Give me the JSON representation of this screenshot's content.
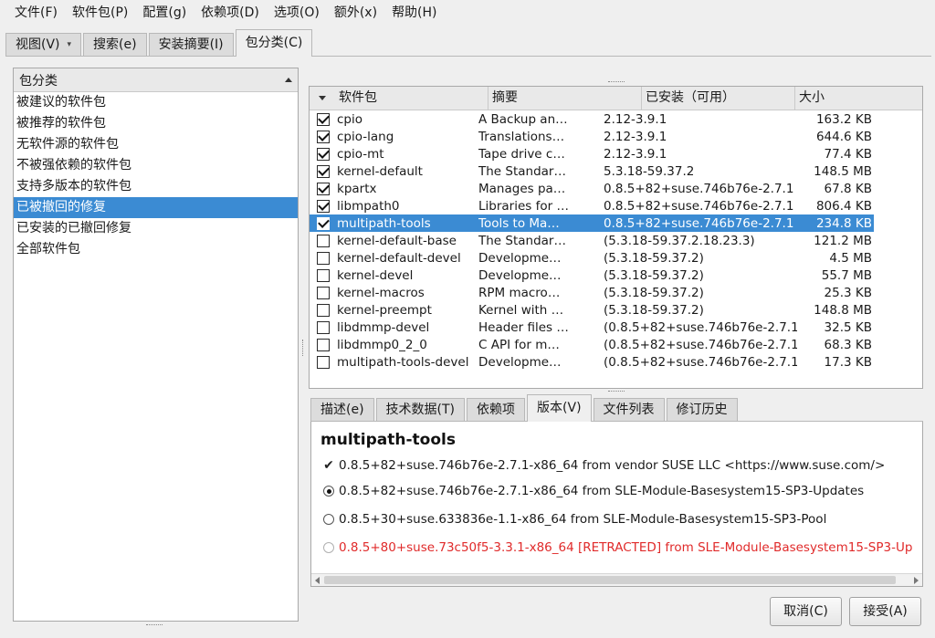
{
  "menubar": [
    "文件(F)",
    "软件包(P)",
    "配置(g)",
    "依赖项(D)",
    "选项(O)",
    "额外(x)",
    "帮助(H)"
  ],
  "main_tabs": [
    {
      "label": "视图(V)",
      "has_dropdown": true,
      "active": false
    },
    {
      "label": "搜索(e)",
      "active": false
    },
    {
      "label": "安装摘要(I)",
      "active": false
    },
    {
      "label": "包分类(C)",
      "active": true
    }
  ],
  "categories": {
    "header": "包分类",
    "items": [
      {
        "label": "被建议的软件包",
        "selected": false
      },
      {
        "label": "被推荐的软件包",
        "selected": false
      },
      {
        "label": "无软件源的软件包",
        "selected": false
      },
      {
        "label": "不被强依赖的软件包",
        "selected": false
      },
      {
        "label": "支持多版本的软件包",
        "selected": false
      },
      {
        "label": "已被撤回的修复",
        "selected": true
      },
      {
        "label": "已安装的已撤回修复",
        "selected": false
      },
      {
        "label": "全部软件包",
        "selected": false
      }
    ]
  },
  "packages": {
    "columns": {
      "name": "软件包",
      "summary": "摘要",
      "version": "已安装（可用）",
      "size": "大小"
    },
    "rows": [
      {
        "checked": true,
        "name": "cpio",
        "summary": "A Backup an…",
        "version": "2.12-3.9.1",
        "size": "163.2 KB",
        "selected": false
      },
      {
        "checked": true,
        "name": "cpio-lang",
        "summary": "Translations…",
        "version": "2.12-3.9.1",
        "size": "644.6 KB",
        "selected": false
      },
      {
        "checked": true,
        "name": "cpio-mt",
        "summary": "Tape drive c…",
        "version": "2.12-3.9.1",
        "size": "77.4 KB",
        "selected": false
      },
      {
        "checked": true,
        "name": "kernel-default",
        "summary": "The Standar…",
        "version": "5.3.18-59.37.2",
        "size": "148.5 MB",
        "selected": false
      },
      {
        "checked": true,
        "name": "kpartx",
        "summary": "Manages pa…",
        "version": "0.8.5+82+suse.746b76e-2.7.1",
        "size": "67.8 KB",
        "selected": false
      },
      {
        "checked": true,
        "name": "libmpath0",
        "summary": "Libraries for …",
        "version": "0.8.5+82+suse.746b76e-2.7.1",
        "size": "806.4 KB",
        "selected": false
      },
      {
        "checked": true,
        "name": "multipath-tools",
        "summary": "Tools to Ma…",
        "version": "0.8.5+82+suse.746b76e-2.7.1",
        "size": "234.8 KB",
        "selected": true
      },
      {
        "checked": false,
        "name": "kernel-default-base",
        "summary": "The Standar…",
        "version": "(5.3.18-59.37.2.18.23.3)",
        "size": "121.2 MB",
        "selected": false
      },
      {
        "checked": false,
        "name": "kernel-default-devel",
        "summary": "Developme…",
        "version": "(5.3.18-59.37.2)",
        "size": "4.5 MB",
        "selected": false
      },
      {
        "checked": false,
        "name": "kernel-devel",
        "summary": "Developme…",
        "version": "(5.3.18-59.37.2)",
        "size": "55.7 MB",
        "selected": false
      },
      {
        "checked": false,
        "name": "kernel-macros",
        "summary": "RPM macro…",
        "version": "(5.3.18-59.37.2)",
        "size": "25.3 KB",
        "selected": false
      },
      {
        "checked": false,
        "name": "kernel-preempt",
        "summary": "Kernel with …",
        "version": "(5.3.18-59.37.2)",
        "size": "148.8 MB",
        "selected": false
      },
      {
        "checked": false,
        "name": "libdmmp-devel",
        "summary": "Header files …",
        "version": "(0.8.5+82+suse.746b76e-2.7.1)",
        "size": "32.5 KB",
        "selected": false
      },
      {
        "checked": false,
        "name": "libdmmp0_2_0",
        "summary": "C API for m…",
        "version": "(0.8.5+82+suse.746b76e-2.7.1)",
        "size": "68.3 KB",
        "selected": false
      },
      {
        "checked": false,
        "name": "multipath-tools-devel",
        "summary": "Developme…",
        "version": "(0.8.5+82+suse.746b76e-2.7.1)",
        "size": "17.3 KB",
        "selected": false
      }
    ]
  },
  "detail_tabs": [
    {
      "label": "描述(e)",
      "active": false
    },
    {
      "label": "技术数据(T)",
      "active": false
    },
    {
      "label": "依赖项",
      "active": false
    },
    {
      "label": "版本(V)",
      "active": true
    },
    {
      "label": "文件列表",
      "active": false
    },
    {
      "label": "修订历史",
      "active": false
    }
  ],
  "versions": {
    "title": "multipath-tools",
    "lines": [
      {
        "mark": "check",
        "text": "0.8.5+82+suse.746b76e-2.7.1-x86_64 from vendor SUSE LLC <https://www.suse.com/>",
        "red": false
      },
      {
        "mark": "radio-on",
        "text": "0.8.5+82+suse.746b76e-2.7.1-x86_64 from SLE-Module-Basesystem15-SP3-Updates",
        "red": false
      },
      {
        "mark": "radio-off",
        "text": "0.8.5+30+suse.633836e-1.1-x86_64 from SLE-Module-Basesystem15-SP3-Pool",
        "red": false
      },
      {
        "mark": "radio-off-disabled",
        "text": "0.8.5+80+suse.73c50f5-3.3.1-x86_64 [RETRACTED] from SLE-Module-Basesystem15-SP3-Up",
        "red": true
      }
    ]
  },
  "buttons": {
    "cancel": "取消(C)",
    "accept": "接受(A)"
  },
  "colors": {
    "selection": "#3b8bd3",
    "retracted": "#e02a2a"
  }
}
